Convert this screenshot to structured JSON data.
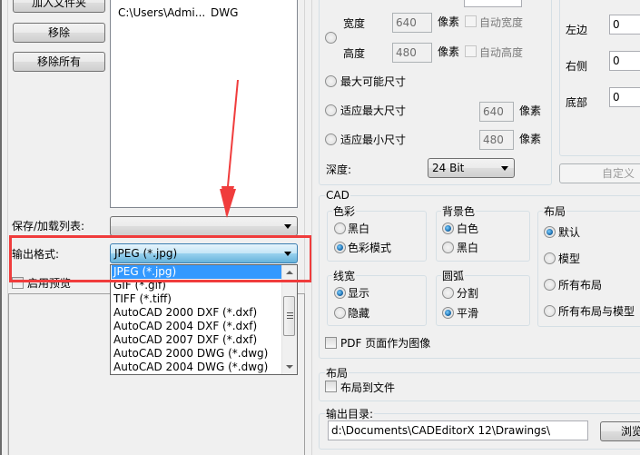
{
  "left_panel": {
    "buttons": {
      "add_folder": "加入文件夹",
      "remove": "移除",
      "remove_all": "移除所有"
    },
    "file_list": [
      {
        "path": "C:\\Users\\Admi...",
        "type": "DWG"
      }
    ],
    "save_load_list_label": "保存/加载列表:",
    "save_load_list_value": "",
    "output_format_label": "输出格式:",
    "output_format_value": "JPEG (*.jpg)",
    "output_format_options": [
      "JPEG (*.jpg)",
      "GIF (*.gif)",
      "TIFF (*.tiff)",
      "AutoCAD 2000 DXF (*.dxf)",
      "AutoCAD 2004 DXF (*.dxf)",
      "AutoCAD 2007 DXF (*.dxf)",
      "AutoCAD 2000 DWG (*.dwg)",
      "AutoCAD 2004 DWG (*.dwg)"
    ],
    "enable_preview_label": "启用预览"
  },
  "image_size": {
    "width_label": "宽度",
    "width_value": "640",
    "height_label": "高度",
    "height_value": "480",
    "pixel_unit": "像素",
    "auto_width_label": "自动宽度",
    "auto_height_label": "自动高度",
    "max_possible_label": "最大可能尺寸",
    "fit_max_label": "适应最大尺寸",
    "fit_max_value": "640",
    "fit_min_label": "适应最小尺寸",
    "fit_min_value": "480",
    "depth_label": "深度:",
    "depth_value": "24 Bit"
  },
  "margins": {
    "left_label": "左边",
    "left_value": "0",
    "right_label": "右侧",
    "right_value": "0",
    "bottom_label": "底部",
    "bottom_value": "0",
    "custom_button": "自定义"
  },
  "cad": {
    "title": "CAD",
    "color": {
      "title": "色彩",
      "options": [
        "黑白",
        "色彩模式"
      ],
      "selected": "色彩模式"
    },
    "background": {
      "title": "背景色",
      "options": [
        "白色",
        "黑白"
      ],
      "selected": "白色"
    },
    "layout": {
      "title": "布局",
      "options": [
        "默认",
        "模型",
        "所有布局",
        "所有布局与模型"
      ],
      "selected": "默认"
    },
    "lineweight": {
      "title": "线宽",
      "options": [
        "显示",
        "隐藏"
      ],
      "selected": "显示"
    },
    "arc": {
      "title": "圆弧",
      "options": [
        "分割",
        "平滑"
      ],
      "selected": "平滑"
    },
    "pdf_as_image_label": "PDF 页面作为图像"
  },
  "layout_section": {
    "title": "布局",
    "layout_to_file_label": "布局到文件"
  },
  "output_dir": {
    "title": "输出目录:",
    "value": "d:\\Documents\\CADEditorX 12\\Drawings\\",
    "browse_button": "浏览"
  },
  "annotation": {
    "arrow_color": "#f03c3c",
    "highlight_color": "#f03c3c"
  }
}
